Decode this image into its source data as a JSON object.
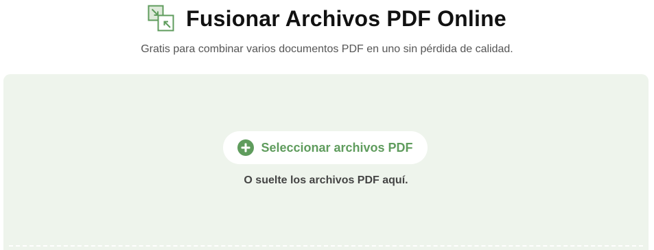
{
  "header": {
    "icon": "merge-pdf-icon",
    "title": "Fusionar Archivos PDF Online"
  },
  "subtitle": "Gratis para combinar varios documentos PDF en uno sin pérdida de calidad.",
  "dropzone": {
    "select_button_icon": "plus-circle-icon",
    "select_button_label": "Seleccionar archivos PDF",
    "drop_hint": "O suelte los archivos PDF aquí."
  },
  "colors": {
    "accent": "#5f9c5d",
    "dropzone_background": "#eef4ec",
    "title": "#111111",
    "subtitle": "#555555"
  }
}
